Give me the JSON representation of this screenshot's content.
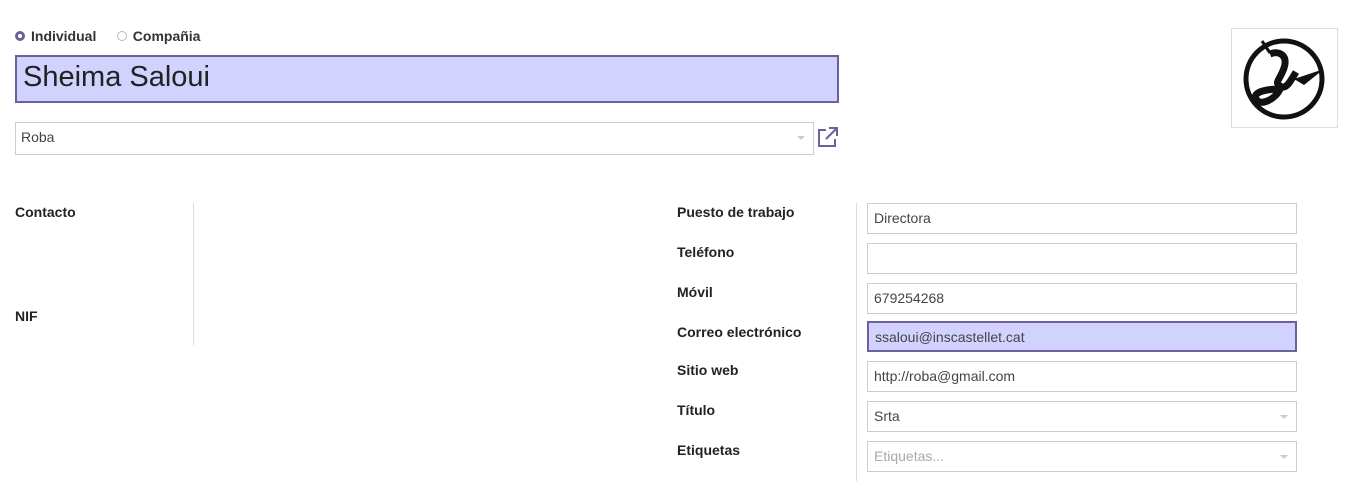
{
  "type_options": [
    {
      "label": "Individual",
      "selected": true
    },
    {
      "label": "Compañia",
      "selected": false
    }
  ],
  "name": "Sheima Saloui",
  "company": "Roba",
  "left_labels": {
    "contact": "Contacto",
    "nif": "NIF"
  },
  "fields": [
    {
      "label": "Puesto de trabajo",
      "value": "Directora"
    },
    {
      "label": "Teléfono",
      "value": ""
    },
    {
      "label": "Móvil",
      "value": "679254268"
    },
    {
      "label": "Correo electrónico",
      "value": "ssaloui@inscastellet.cat"
    },
    {
      "label": "Sitio web",
      "value": "http://roba@gmail.com"
    },
    {
      "label": "Título",
      "value": "Srta"
    },
    {
      "label": "Etiquetas",
      "value": "",
      "placeholder": "Etiquetas..."
    }
  ],
  "colors": {
    "accent": "#6e5f9d",
    "highlight": "#d2d2ff"
  }
}
